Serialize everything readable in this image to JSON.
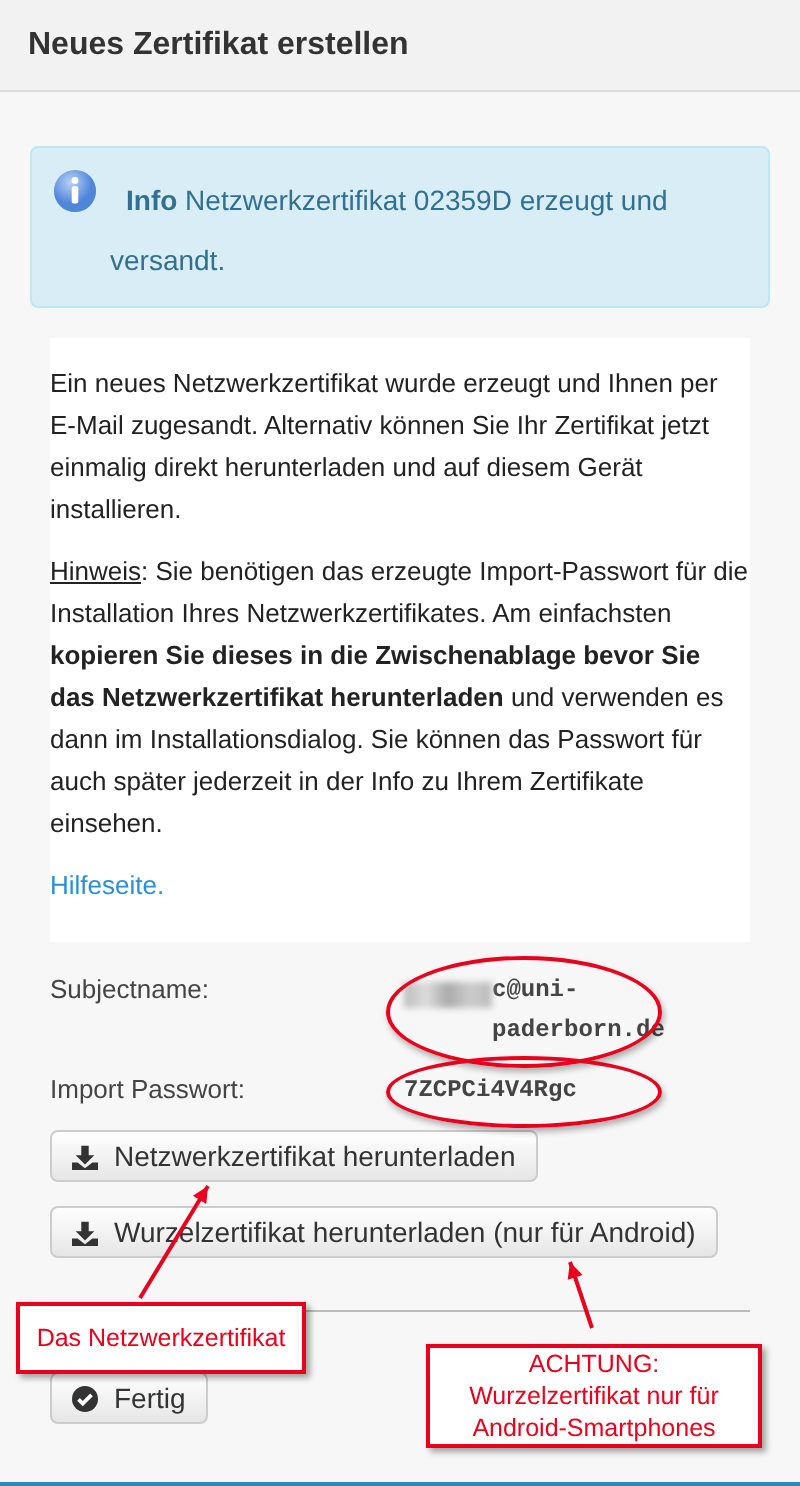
{
  "header": {
    "title": "Neues Zertifikat erstellen"
  },
  "alert": {
    "label": "Info",
    "text": "Netzwerkzertifikat 02359D erzeugt und versandt."
  },
  "intro": "Ein neues Netzwerkzertifikat wurde erzeugt und Ihnen per E-Mail zugesandt. Alternativ können Sie Ihr Zertifikat jetzt einmalig direkt herunterladen und auf diesem Gerät installieren.",
  "hint": {
    "label": "Hinweis",
    "text": ": Sie benötigen das erzeugte Import-Passwort für die Installation Ihres Netzwerkzertifikates. Am einfachsten **kopieren Sie dieses in die Zwischenablage bevor Sie das Netzwerkzertifikat herunterladen** und verwenden es dann im Installationsdialog. Sie können das Passwort für auch später jederzeit in der Info zu Ihrem Zertifikate einsehen."
  },
  "help_link": "Hilfeseite.",
  "fields": [
    {
      "label": "Subjectname:",
      "value": "c@uni-paderborn.de",
      "redacted": true
    },
    {
      "label": "Import Passwort:",
      "value": "7ZCPCi4V4Rgc",
      "redacted": false
    }
  ],
  "download_buttons": [
    "Netzwerkzertifikat herunterladen",
    "Wurzelzertifikat herunterladen (nur für Android)"
  ],
  "done_button": "Fertig",
  "annotations": [
    {
      "text": "Das Netzwerkzertifikat"
    },
    {
      "text": "ACHTUNG: Wurzelzertifikat nur für Android-Smartphones"
    }
  ]
}
